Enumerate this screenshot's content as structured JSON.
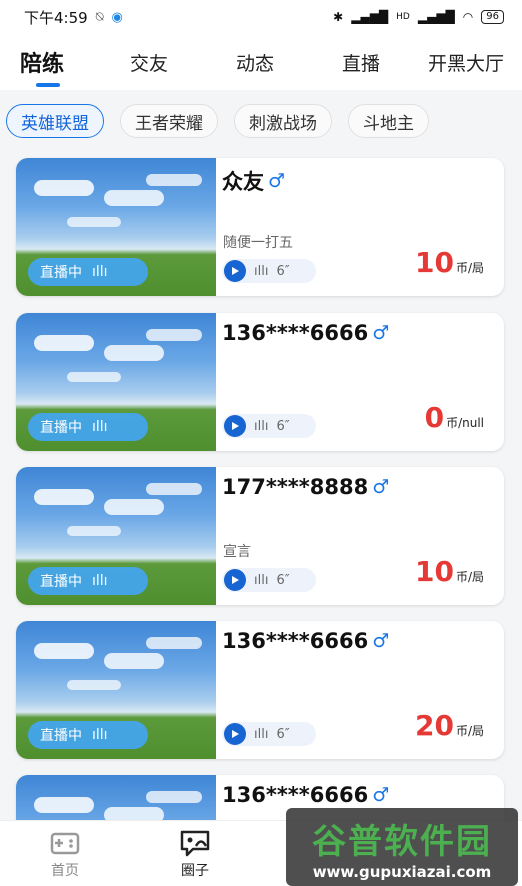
{
  "status_bar": {
    "time": "下午4:59",
    "network": "HD",
    "battery": "96"
  },
  "tabs": [
    {
      "label": "陪练",
      "active": true
    },
    {
      "label": "交友",
      "active": false
    },
    {
      "label": "动态",
      "active": false
    },
    {
      "label": "直播",
      "active": false
    },
    {
      "label": "开黑大厅",
      "active": false
    }
  ],
  "categories": [
    {
      "label": "英雄联盟",
      "active": true
    },
    {
      "label": "王者荣耀",
      "active": false
    },
    {
      "label": "刺激战场",
      "active": false
    },
    {
      "label": "斗地主",
      "active": false
    }
  ],
  "cards": [
    {
      "name": "众友",
      "gender_icon": "male-icon",
      "slogan": "随便一打五",
      "live_label": "直播中",
      "voice_duration": "6″",
      "price": "10",
      "price_unit": "币/局"
    },
    {
      "name": "136****6666",
      "gender_icon": "male-icon",
      "slogan": "",
      "live_label": "直播中",
      "voice_duration": "6″",
      "price": "0",
      "price_unit": "币/null"
    },
    {
      "name": "177****8888",
      "gender_icon": "male-icon",
      "slogan": "宣言",
      "live_label": "直播中",
      "voice_duration": "6″",
      "price": "10",
      "price_unit": "币/局"
    },
    {
      "name": "136****6666",
      "gender_icon": "male-icon",
      "slogan": "",
      "live_label": "直播中",
      "voice_duration": "6″",
      "price": "20",
      "price_unit": "币/局"
    },
    {
      "name": "136****6666",
      "gender_icon": "male-icon",
      "slogan": "",
      "live_label": "",
      "voice_duration": "",
      "price": "",
      "price_unit": ""
    }
  ],
  "bottom_nav": [
    {
      "label": "首页",
      "icon": "gamepad-icon",
      "active": false
    },
    {
      "label": "圈子",
      "icon": "chat-bubble-icon",
      "active": true
    }
  ],
  "watermark": {
    "title": "谷普软件园",
    "url": "www.gupuxiazai.com"
  },
  "colors": {
    "accent": "#1976e6",
    "price": "#e53935",
    "live_badge": "#42a5f5"
  }
}
